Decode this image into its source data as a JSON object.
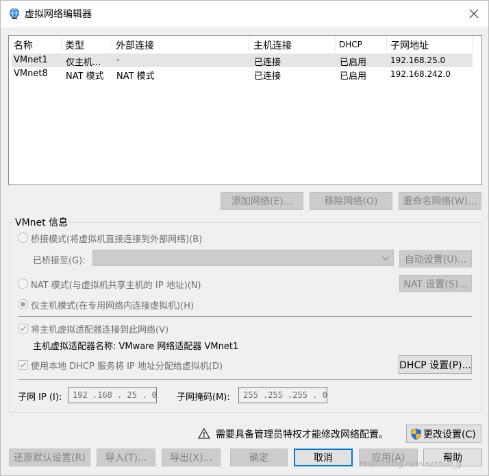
{
  "window": {
    "title": "虚拟网络编辑器",
    "icon": "globe-network-icon"
  },
  "list": {
    "headers": [
      "名称",
      "类型",
      "外部连接",
      "主机连接",
      "DHCP",
      "子网地址"
    ],
    "rows": [
      [
        "VMnet1",
        "仅主机...",
        "-",
        "已连接",
        "已启用",
        "192.168.25.0"
      ],
      [
        "VMnet8",
        "NAT 模式",
        "NAT 模式",
        "已连接",
        "已启用",
        "192.168.242.0"
      ]
    ],
    "selected_row": 0
  },
  "list_buttons": {
    "add": "添加网络(E)...",
    "remove": "移除网络(O)",
    "rename": "重命名网络(W)..."
  },
  "vmnet_info": {
    "legend": "VMnet 信息",
    "bridged_label": "桥接模式(将虚拟机直接连接到外部网络)(B)",
    "bridged_to_label": "已桥接至(G):",
    "bridged_to_value": "",
    "auto_settings": "自动设置(U)...",
    "nat_label": "NAT 模式(与虚拟机共享主机的 IP 地址)(N)",
    "nat_settings": "NAT 设置(S)...",
    "hostonly_label": "仅主机模式(在专用网络内连接虚拟机)(H)",
    "connect_adapter_label": "将主机虚拟适配器连接到此网络(V)",
    "adapter_name_label": "主机虚拟适配器名称: VMware 网络适配器 VMnet1",
    "dhcp_label": "使用本地 DHCP 服务将 IP 地址分配给虚拟机(D)",
    "dhcp_settings": "DHCP 设置(P)...",
    "subnet_ip_label": "子网 IP (I):",
    "subnet_ip_value": "192 .168 . 25  .  0",
    "subnet_mask_label": "子网掩码(M):",
    "subnet_mask_value": "255 .255 .255 .  0"
  },
  "admin": {
    "warning": "需要具备管理员特权才能修改网络配置。",
    "change_settings": "更改设置(C)"
  },
  "footer": {
    "restore": "还原默认设置(R)",
    "import": "导入(T)...",
    "export": "导出(X)...",
    "ok": "确定",
    "cancel": "取消",
    "apply": "应用(A)",
    "help": "帮助"
  },
  "watermark": "https://blog.csdn.net/lulz_g",
  "colors": {
    "accent": "#0078d7",
    "selected_row": "#e5e5e5",
    "disabled_button": "#cccccc"
  }
}
